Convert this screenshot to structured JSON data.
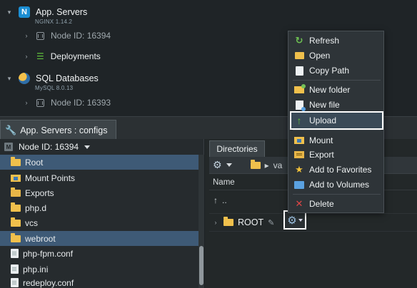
{
  "env_tree": {
    "app_servers": {
      "title": "App. Servers",
      "subtitle": "NGINX 1.14.2",
      "node": "Node ID: 16394",
      "deployments": "Deployments"
    },
    "sql": {
      "title": "SQL Databases",
      "subtitle": "MySQL 8.0.13",
      "node": "Node ID: 16393"
    }
  },
  "tab": {
    "label": "App. Servers : configs"
  },
  "left_panel": {
    "node_select": "Node ID: 16394",
    "items": [
      {
        "label": "Root",
        "icon": "folder-icon",
        "selected": true
      },
      {
        "label": "Mount Points",
        "icon": "mount-folder-icon",
        "selected": false
      },
      {
        "label": "Exports",
        "icon": "export-folder-icon",
        "selected": false
      },
      {
        "label": "php.d",
        "icon": "folder-icon",
        "selected": false
      },
      {
        "label": "vcs",
        "icon": "folder-icon",
        "selected": false
      },
      {
        "label": "webroot",
        "icon": "folder-icon",
        "selected": true
      },
      {
        "label": "php-fpm.conf",
        "icon": "file-icon",
        "selected": false
      },
      {
        "label": "php.ini",
        "icon": "file-icon",
        "selected": false
      },
      {
        "label": "redeploy.conf",
        "icon": "file-icon",
        "selected": false
      }
    ]
  },
  "right_panel": {
    "tab": "Directories",
    "path_fragment": "va",
    "header_name": "Name",
    "up_label": "..",
    "row_label": "ROOT"
  },
  "context_menu": {
    "items": [
      {
        "label": "Refresh",
        "icon": "refresh-icon"
      },
      {
        "label": "Open",
        "icon": "folder-open-icon"
      },
      {
        "label": "Copy Path",
        "icon": "copy-icon"
      },
      {
        "label": "New folder",
        "icon": "new-folder-icon"
      },
      {
        "label": "New file",
        "icon": "new-file-icon"
      },
      {
        "label": "Upload",
        "icon": "upload-icon",
        "highlighted": true
      },
      {
        "label": "Mount",
        "icon": "mount-icon"
      },
      {
        "label": "Export",
        "icon": "export-icon"
      },
      {
        "label": "Add to Favorites",
        "icon": "star-icon"
      },
      {
        "label": "Add to Volumes",
        "icon": "volume-icon"
      },
      {
        "label": "Delete",
        "icon": "delete-icon"
      }
    ]
  },
  "colors": {
    "selection": "#3e5a76",
    "highlight_border": "#ffffff",
    "folder": "#f0c04c"
  }
}
